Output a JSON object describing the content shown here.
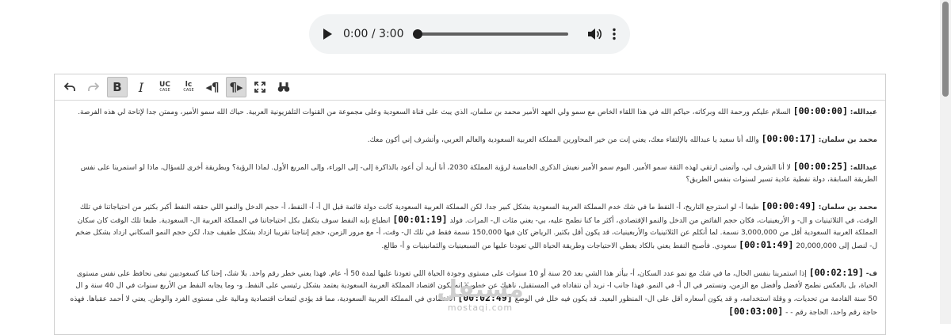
{
  "player": {
    "time": "0:00 / 3:00",
    "progress": 0,
    "icons": {
      "play": "play-icon",
      "volume": "volume-icon",
      "more": "more-options-icon"
    }
  },
  "toolbar": {
    "uc_label": "UC",
    "uc_sub": "CASE",
    "lc_label": "lc",
    "lc_sub": "CASE",
    "bold_label": "B",
    "italic_label": "I",
    "ltr_label": "¶",
    "rtl_label": "¶",
    "icons": [
      "undo-icon",
      "redo-icon",
      "bold-icon",
      "italic-icon",
      "uppercase-icon",
      "lowercase-icon",
      "ltr-paragraph-icon",
      "rtl-paragraph-icon",
      "fullscreen-icon",
      "find-icon"
    ]
  },
  "transcript": [
    {
      "speaker": "عبدالله:",
      "ts": "[00:00:00]",
      "text": "السلام عليكم ورحمة الله وبركاته، حياكم الله في هذا اللقاء الخاص مع سمو ولي العهد الأمير محمد بن سلمان، الذي يبث على قناة السعودية وعلى مجموعة من القنوات التلفزيونية العربية. حياك الله سمو الأمير، وممتن جدا لإتاحة لي هذه الفرصة."
    },
    {
      "speaker": "محمد بن سلمان:",
      "ts": "[00:00:17]",
      "text": "والله أنا سعيد يا عبدالله بالإلتقاء معك، يعني إنت من خير المحاورين المملكة العربية السعودية والعالم العربي، وأتشرف إني أكون معك."
    },
    {
      "speaker": "عبدالله:",
      "ts": "[00:00:25]",
      "text": "لا أنا الشرف لي، وأتمنى ارتقي لهذه الثقة سمو الأمير. اليوم سمو الأمير نعيش الذكرى الخامسة لرؤية المملكة 2030، أنا أريد أن أعود بالذاكرة إلى- إلى الوراء، وإلى المربع الأول. لماذا الرؤية؟ وبطريقة أخرى للسؤال، ماذا لو استمرينا على نفس الطريقة السابقة، دولة نفطية عادية تسير لسنوات بنفس الطريق؟"
    },
    {
      "speaker": "محمد بن سلمان:",
      "ts": "[00:00:49]",
      "text": "طبعا أ- لو استرجع التاريخ، أ- النفط ما في شك خدم المملكة العربية السعودية بشكل كبير جدا. لكن المملكة العربية السعودية كانت دولة قائمة قبل ال أ- أ- النفط، أ- حجم الدخل والنمو اللي حققه النفط أكبر بكثير من احتياجاتنا في تلك الوقت، في الثلاثينيات و ال- و الأربعينيات، فكان حجم الفائض من الدخل والنمو الإقتصادي، أكثر ما كنا نطمح عليه، بي- يعني مئات ال- المرات. فولد",
      "ts2": "[00:01:19]",
      "text2": "انطباع بإنه النفط سوف يتكفل بكل احتياجاتنا في المملكة العربية ال- السعودية. طبعا تلك الوقت كان سكان المملكة العربية السعودية أقل من 3,000,000 نسمة. لما أتكلم عن الثلاثينيات والأربعينيات، قد يكون أقل بكثير. الرياض كان فيها 150,000 نسمة فقط في تلك ال- وقت، أ- مع مرور الزمن، حجم إنتاجنا تقريبا ازداد بشكل طفيف جدا، لكن حجم النمو السكاني ازداد بشكل ضخم ل- لنصل إلى 20,000,000",
      "ts3": "[00:01:49]",
      "text3": "سعودي. فأصبح النفط يعني بالكاد يغطي الاحتياجات وطريقة الحياة اللي تعودنا عليها من السبعينيات والثمانينيات و أ- طالع."
    },
    {
      "speaker": "ف-",
      "ts": "[00:02:19]",
      "text": "إذا استمرينا بنفس الحال، ما في شك مع نمو عدد السكان، أ- بيأثر هذا الشي بعد 20 سنة أو 10 سنوات على مستوى وجودة الحياة اللي تعودنا عليها لمدة 50 أ- عام. فهذا يعني خطر رقم واحد. بلا شك، إحنا كنا كسعوديين نبغى نحافظ على نفس مستوى الحياة، بل بالعكس نطمح لأفضل وأفضل مع الزمن، ونستمر في ال أ- في النمو. فهذا جانب ا- نريد أن نتفاداه في المستقبل، ناهيك عن خطورة إنه يكون اقتصاد المملكة العربية السعودية يعتمد بشكل رئيسي على النفط. و- وما يجابه النفط من الأربع سنوات في ال 40 سنة و ال 50 سنة القادمة من تحديات، و وقلة استخدامه، و قد يكون أسعاره أقل على ال- المنظور البعيد. قد يكون فيه خلل في الوضع",
      "ts2": "[00:02:49]",
      "text2": "الاقتصادي في المملكة العربية السعودية، مما قد يؤدي لتبعات اقتصادية ومالية على مستوى الفرد والوطن. يعني لا أحمد عقباها. فهذه حاجة رقم واحد، الحاجة رقم - -",
      "ts3": "[00:03:00]",
      "text3": ""
    }
  ],
  "watermark": {
    "arabic": "مستقل",
    "latin": "mostaqi.com"
  }
}
